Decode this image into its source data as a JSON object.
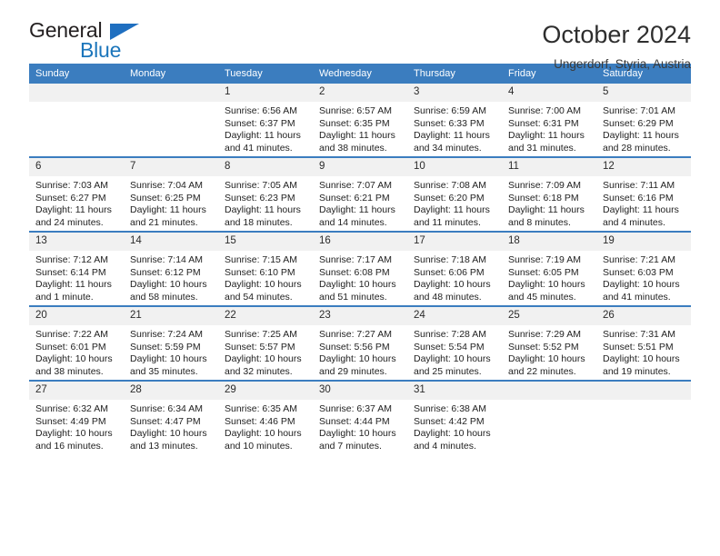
{
  "brand": {
    "name_top": "General",
    "name_bottom": "Blue",
    "accent_color": "#1b75bb",
    "triangle_color": "#1f6fc0"
  },
  "header": {
    "title": "October 2024",
    "subtitle": "Ungerdorf, Styria, Austria"
  },
  "calendar": {
    "header_bg": "#3b7dbf",
    "daynum_bg": "#f1f1f1",
    "weekdays": [
      "Sunday",
      "Monday",
      "Tuesday",
      "Wednesday",
      "Thursday",
      "Friday",
      "Saturday"
    ],
    "weeks": [
      [
        {
          "day": "",
          "blank": true
        },
        {
          "day": "",
          "blank": true
        },
        {
          "day": "1",
          "sunrise": "Sunrise: 6:56 AM",
          "sunset": "Sunset: 6:37 PM",
          "daylight": "Daylight: 11 hours and 41 minutes."
        },
        {
          "day": "2",
          "sunrise": "Sunrise: 6:57 AM",
          "sunset": "Sunset: 6:35 PM",
          "daylight": "Daylight: 11 hours and 38 minutes."
        },
        {
          "day": "3",
          "sunrise": "Sunrise: 6:59 AM",
          "sunset": "Sunset: 6:33 PM",
          "daylight": "Daylight: 11 hours and 34 minutes."
        },
        {
          "day": "4",
          "sunrise": "Sunrise: 7:00 AM",
          "sunset": "Sunset: 6:31 PM",
          "daylight": "Daylight: 11 hours and 31 minutes."
        },
        {
          "day": "5",
          "sunrise": "Sunrise: 7:01 AM",
          "sunset": "Sunset: 6:29 PM",
          "daylight": "Daylight: 11 hours and 28 minutes."
        }
      ],
      [
        {
          "day": "6",
          "sunrise": "Sunrise: 7:03 AM",
          "sunset": "Sunset: 6:27 PM",
          "daylight": "Daylight: 11 hours and 24 minutes."
        },
        {
          "day": "7",
          "sunrise": "Sunrise: 7:04 AM",
          "sunset": "Sunset: 6:25 PM",
          "daylight": "Daylight: 11 hours and 21 minutes."
        },
        {
          "day": "8",
          "sunrise": "Sunrise: 7:05 AM",
          "sunset": "Sunset: 6:23 PM",
          "daylight": "Daylight: 11 hours and 18 minutes."
        },
        {
          "day": "9",
          "sunrise": "Sunrise: 7:07 AM",
          "sunset": "Sunset: 6:21 PM",
          "daylight": "Daylight: 11 hours and 14 minutes."
        },
        {
          "day": "10",
          "sunrise": "Sunrise: 7:08 AM",
          "sunset": "Sunset: 6:20 PM",
          "daylight": "Daylight: 11 hours and 11 minutes."
        },
        {
          "day": "11",
          "sunrise": "Sunrise: 7:09 AM",
          "sunset": "Sunset: 6:18 PM",
          "daylight": "Daylight: 11 hours and 8 minutes."
        },
        {
          "day": "12",
          "sunrise": "Sunrise: 7:11 AM",
          "sunset": "Sunset: 6:16 PM",
          "daylight": "Daylight: 11 hours and 4 minutes."
        }
      ],
      [
        {
          "day": "13",
          "sunrise": "Sunrise: 7:12 AM",
          "sunset": "Sunset: 6:14 PM",
          "daylight": "Daylight: 11 hours and 1 minute."
        },
        {
          "day": "14",
          "sunrise": "Sunrise: 7:14 AM",
          "sunset": "Sunset: 6:12 PM",
          "daylight": "Daylight: 10 hours and 58 minutes."
        },
        {
          "day": "15",
          "sunrise": "Sunrise: 7:15 AM",
          "sunset": "Sunset: 6:10 PM",
          "daylight": "Daylight: 10 hours and 54 minutes."
        },
        {
          "day": "16",
          "sunrise": "Sunrise: 7:17 AM",
          "sunset": "Sunset: 6:08 PM",
          "daylight": "Daylight: 10 hours and 51 minutes."
        },
        {
          "day": "17",
          "sunrise": "Sunrise: 7:18 AM",
          "sunset": "Sunset: 6:06 PM",
          "daylight": "Daylight: 10 hours and 48 minutes."
        },
        {
          "day": "18",
          "sunrise": "Sunrise: 7:19 AM",
          "sunset": "Sunset: 6:05 PM",
          "daylight": "Daylight: 10 hours and 45 minutes."
        },
        {
          "day": "19",
          "sunrise": "Sunrise: 7:21 AM",
          "sunset": "Sunset: 6:03 PM",
          "daylight": "Daylight: 10 hours and 41 minutes."
        }
      ],
      [
        {
          "day": "20",
          "sunrise": "Sunrise: 7:22 AM",
          "sunset": "Sunset: 6:01 PM",
          "daylight": "Daylight: 10 hours and 38 minutes."
        },
        {
          "day": "21",
          "sunrise": "Sunrise: 7:24 AM",
          "sunset": "Sunset: 5:59 PM",
          "daylight": "Daylight: 10 hours and 35 minutes."
        },
        {
          "day": "22",
          "sunrise": "Sunrise: 7:25 AM",
          "sunset": "Sunset: 5:57 PM",
          "daylight": "Daylight: 10 hours and 32 minutes."
        },
        {
          "day": "23",
          "sunrise": "Sunrise: 7:27 AM",
          "sunset": "Sunset: 5:56 PM",
          "daylight": "Daylight: 10 hours and 29 minutes."
        },
        {
          "day": "24",
          "sunrise": "Sunrise: 7:28 AM",
          "sunset": "Sunset: 5:54 PM",
          "daylight": "Daylight: 10 hours and 25 minutes."
        },
        {
          "day": "25",
          "sunrise": "Sunrise: 7:29 AM",
          "sunset": "Sunset: 5:52 PM",
          "daylight": "Daylight: 10 hours and 22 minutes."
        },
        {
          "day": "26",
          "sunrise": "Sunrise: 7:31 AM",
          "sunset": "Sunset: 5:51 PM",
          "daylight": "Daylight: 10 hours and 19 minutes."
        }
      ],
      [
        {
          "day": "27",
          "sunrise": "Sunrise: 6:32 AM",
          "sunset": "Sunset: 4:49 PM",
          "daylight": "Daylight: 10 hours and 16 minutes."
        },
        {
          "day": "28",
          "sunrise": "Sunrise: 6:34 AM",
          "sunset": "Sunset: 4:47 PM",
          "daylight": "Daylight: 10 hours and 13 minutes."
        },
        {
          "day": "29",
          "sunrise": "Sunrise: 6:35 AM",
          "sunset": "Sunset: 4:46 PM",
          "daylight": "Daylight: 10 hours and 10 minutes."
        },
        {
          "day": "30",
          "sunrise": "Sunrise: 6:37 AM",
          "sunset": "Sunset: 4:44 PM",
          "daylight": "Daylight: 10 hours and 7 minutes."
        },
        {
          "day": "31",
          "sunrise": "Sunrise: 6:38 AM",
          "sunset": "Sunset: 4:42 PM",
          "daylight": "Daylight: 10 hours and 4 minutes."
        },
        {
          "day": "",
          "blank": true
        },
        {
          "day": "",
          "blank": true
        }
      ]
    ]
  }
}
